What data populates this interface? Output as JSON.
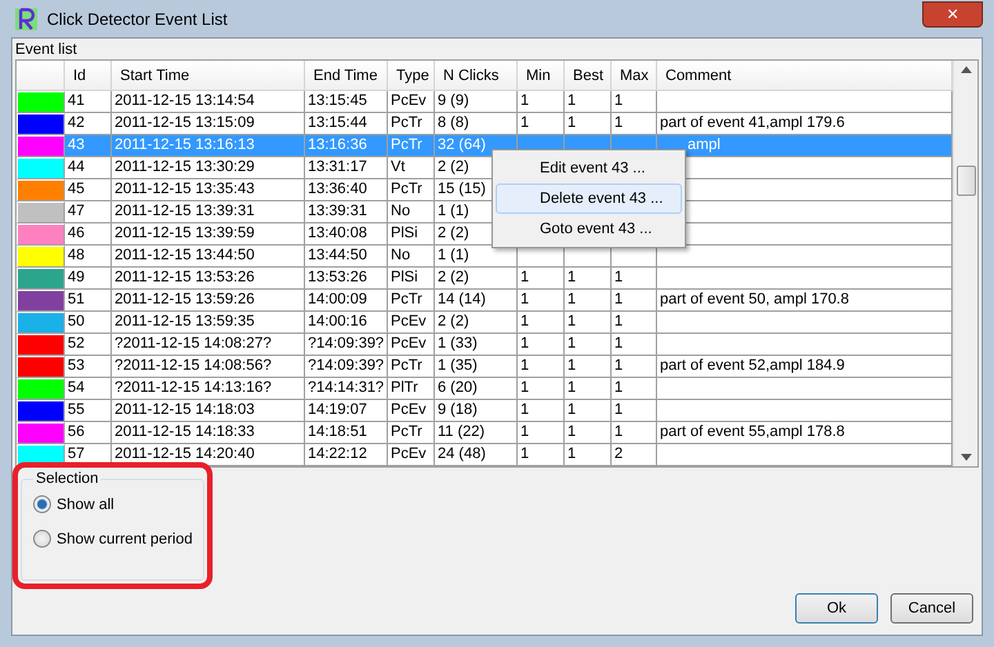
{
  "window": {
    "title": "Click Detector Event List",
    "close": "✕"
  },
  "event_list": {
    "label": "Event list",
    "columns": [
      "Id",
      "Start Time",
      "End Time",
      "Type",
      "N Clicks",
      "Min",
      "Best",
      "Max",
      "Comment"
    ],
    "rows": [
      {
        "color": "#00ff00",
        "id": "41",
        "start": "2011-12-15 13:14:54",
        "end": "13:15:45",
        "type": "PcEv",
        "clicks": "9 (9)",
        "min": "1",
        "best": "1",
        "max": "1",
        "selected": false
      },
      {
        "color": "#0000ff",
        "id": "42",
        "start": "2011-12-15 13:15:09",
        "end": "13:15:44",
        "type": "PcTr",
        "clicks": "8 (8)",
        "min": "1",
        "best": "1",
        "max": "1",
        "comment": "part of event 41,ampl 179.6",
        "selected": false
      },
      {
        "color": "#ff00ff",
        "id": "43",
        "start": "2011-12-15 13:16:13",
        "end": "13:16:36",
        "type": "PcTr",
        "clicks": "32 (64)",
        "comment": "ampl",
        "comment_partly_hidden": true,
        "selected": true
      },
      {
        "color": "#00ffff",
        "id": "44",
        "start": "2011-12-15 13:30:29",
        "end": "13:31:17",
        "type": "Vt",
        "clicks": "2 (2)",
        "selected": false
      },
      {
        "color": "#ff8000",
        "id": "45",
        "start": "2011-12-15 13:35:43",
        "end": "13:36:40",
        "type": "PcTr",
        "clicks": "15 (15)",
        "selected": false
      },
      {
        "color": "#c0c0c0",
        "id": "47",
        "start": "2011-12-15 13:39:31",
        "end": "13:39:31",
        "type": "No",
        "clicks": "1 (1)",
        "selected": false
      },
      {
        "color": "#ff80c0",
        "id": "46",
        "start": "2011-12-15 13:39:59",
        "end": "13:40:08",
        "type": "PlSi",
        "clicks": "2 (2)",
        "selected": false
      },
      {
        "color": "#ffff00",
        "id": "48",
        "start": "2011-12-15 13:44:50",
        "end": "13:44:50",
        "type": "No",
        "clicks": "1 (1)",
        "selected": false
      },
      {
        "color": "#2ca58d",
        "id": "49",
        "start": "2011-12-15 13:53:26",
        "end": "13:53:26",
        "type": "PlSi",
        "clicks": "2 (2)",
        "min": "1",
        "best": "1",
        "max": "1",
        "selected": false
      },
      {
        "color": "#8040a0",
        "id": "51",
        "start": "2011-12-15 13:59:26",
        "end": "14:00:09",
        "type": "PcTr",
        "clicks": "14 (14)",
        "min": "1",
        "best": "1",
        "max": "1",
        "comment": "part of event 50, ampl 170.8",
        "selected": false
      },
      {
        "color": "#1ab0e8",
        "id": "50",
        "start": "2011-12-15 13:59:35",
        "end": "14:00:16",
        "type": "PcEv",
        "clicks": "2 (2)",
        "min": "1",
        "best": "1",
        "max": "1",
        "selected": false
      },
      {
        "color": "#ff0000",
        "id": "52",
        "start": "?2011-12-15 14:08:27?",
        "end": "?14:09:39?",
        "type": "PcEv",
        "clicks": "1 (33)",
        "min": "1",
        "best": "1",
        "max": "1",
        "selected": false
      },
      {
        "color": "#ff0000",
        "id": "53",
        "start": "?2011-12-15 14:08:56?",
        "end": "?14:09:39?",
        "type": "PcTr",
        "clicks": "1 (35)",
        "min": "1",
        "best": "1",
        "max": "1",
        "comment": "part of event 52,ampl 184.9",
        "selected": false
      },
      {
        "color": "#00ff00",
        "id": "54",
        "start": "?2011-12-15 14:13:16?",
        "end": "?14:14:31?",
        "type": "PlTr",
        "clicks": "6 (20)",
        "min": "1",
        "best": "1",
        "max": "1",
        "selected": false
      },
      {
        "color": "#0000ff",
        "id": "55",
        "start": "2011-12-15 14:18:03",
        "end": "14:19:07",
        "type": "PcEv",
        "clicks": "9 (18)",
        "min": "1",
        "best": "1",
        "max": "1",
        "selected": false
      },
      {
        "color": "#ff00ff",
        "id": "56",
        "start": "2011-12-15 14:18:33",
        "end": "14:18:51",
        "type": "PcTr",
        "clicks": "11 (22)",
        "min": "1",
        "best": "1",
        "max": "1",
        "comment": "part of event 55,ampl 178.8",
        "selected": false
      },
      {
        "color": "#00ffff",
        "id": "57",
        "start": "2011-12-15 14:20:40",
        "end": "14:22:12",
        "type": "PcEv",
        "clicks": "24 (48)",
        "min": "1",
        "best": "1",
        "max": "2",
        "selected": false
      }
    ]
  },
  "context_menu": [
    {
      "label": "Edit event 43 ...",
      "selected": false
    },
    {
      "label": "Delete event 43 ...",
      "selected": true
    },
    {
      "label": "Goto event 43 ..."
    }
  ],
  "selection": {
    "label": "Selection",
    "options": [
      {
        "label": "Show all",
        "selected": true
      },
      {
        "label": "Show current period",
        "selected": false
      }
    ],
    "highlighted": true
  },
  "buttons": [
    {
      "label": "Ok",
      "default": true
    },
    {
      "label": "Cancel",
      "default": false
    }
  ]
}
